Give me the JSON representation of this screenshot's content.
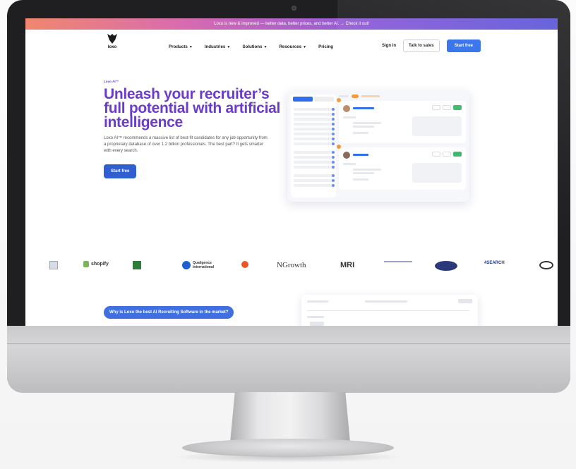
{
  "announcement": "Loxo is new & improved — better data, better prices, and better AI. → Check it out!",
  "brand": {
    "name": "loxo",
    "accent": "#6a3cc9",
    "button_blue": "#2f6dea"
  },
  "nav": {
    "links": [
      {
        "label": "Products",
        "has_caret": true
      },
      {
        "label": "Industries",
        "has_caret": true
      },
      {
        "label": "Solutions",
        "has_caret": true
      },
      {
        "label": "Resources",
        "has_caret": true
      },
      {
        "label": "Pricing",
        "has_caret": false
      }
    ],
    "sign_in": "Sign in",
    "talk_to_sales": "Talk to sales",
    "start_free": "Start free"
  },
  "hero": {
    "eyebrow": "Loxo AI™",
    "headline": "Unleash your recruiter’s full potential with artificial intelligence",
    "subtext": "Loxo AI™ recommends a massive list of best-fit candidates for any job opportunity from a proprietary database of over 1.2 billion professionals. The best part? It gets smarter with every search.",
    "cta": "Start free"
  },
  "partners": [
    "shopify",
    "Qualigence International",
    "NGrowth",
    "MRI",
    "4SEARCH"
  ],
  "why_pill": "Why is Loxo the best AI Recruiting Software in the market?"
}
